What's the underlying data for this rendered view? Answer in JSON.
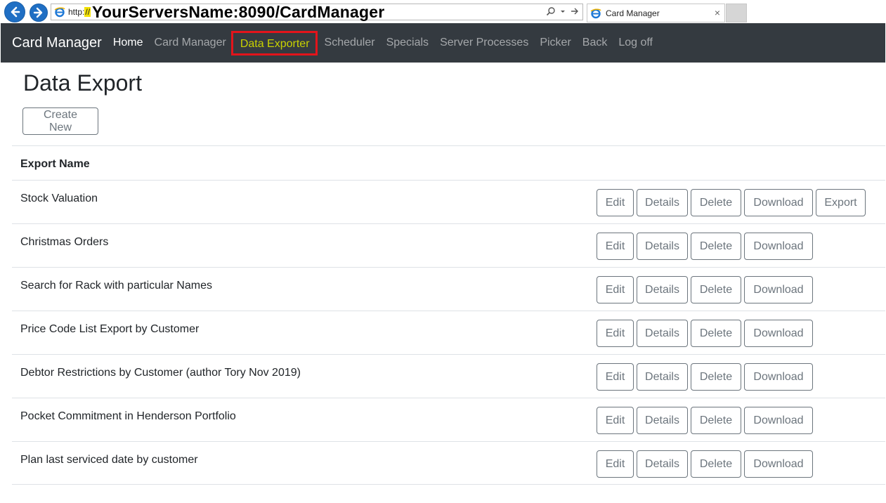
{
  "browser": {
    "url_protocol": "http:",
    "url_slashes": "//",
    "url_main": "YourServersName:8090/CardManager",
    "tab_title": "Card Manager",
    "tab_close": "×"
  },
  "navbar": {
    "brand": "Card Manager",
    "links": [
      "Home",
      "Card Manager",
      "Data Exporter",
      "Scheduler",
      "Specials",
      "Server Processes",
      "Picker",
      "Back",
      "Log off"
    ],
    "active_link": "Data Exporter",
    "highlight_color": "#e3141b"
  },
  "page": {
    "title": "Data Export",
    "create_label": "Create New"
  },
  "table": {
    "header": "Export Name",
    "button_labels": {
      "edit": "Edit",
      "details": "Details",
      "delete": "Delete",
      "download": "Download",
      "export": "Export"
    },
    "rows": [
      {
        "name": "Stock Valuation",
        "has_export": true
      },
      {
        "name": "Christmas Orders",
        "has_export": false
      },
      {
        "name": "Search for Rack with particular Names",
        "has_export": false
      },
      {
        "name": "Price Code List Export by Customer",
        "has_export": false
      },
      {
        "name": "Debtor Restrictions by Customer (author Tory Nov 2019)",
        "has_export": false
      },
      {
        "name": "Pocket Commitment in Henderson Portfolio",
        "has_export": false
      },
      {
        "name": "Plan last serviced date by customer",
        "has_export": false
      }
    ]
  }
}
